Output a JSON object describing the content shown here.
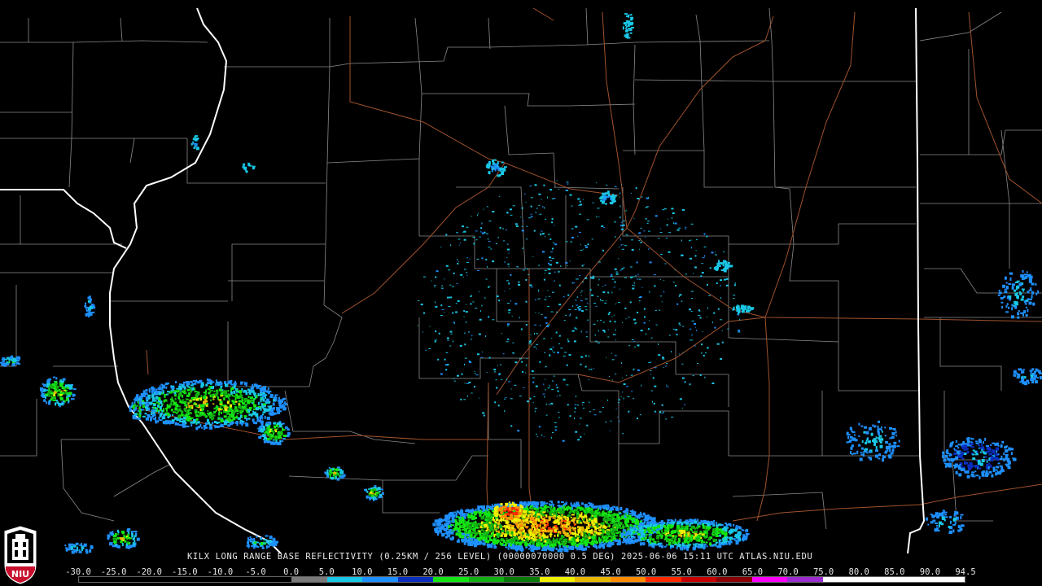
{
  "product_caption": "KILX LONG RANGE BASE REFLECTIVITY (0.25KM / 256 LEVEL) (00000070000 0.5 DEG) 2025-06-06 15:11 UTC  ATLAS.NIU.EDU",
  "logo_text": "NIU",
  "scale": {
    "labels": [
      "-30.0",
      "-25.0",
      "-20.0",
      "-15.0",
      "-10.0",
      "-5.0",
      "0.0",
      "5.0",
      "10.0",
      "15.0",
      "20.0",
      "25.0",
      "30.0",
      "35.0",
      "40.0",
      "45.0",
      "50.0",
      "55.0",
      "60.0",
      "65.0",
      "70.0",
      "75.0",
      "80.0",
      "85.0",
      "90.0",
      "94.5"
    ],
    "colors": [
      "#000000",
      "#000000",
      "#000000",
      "#000000",
      "#000000",
      "#000000",
      "#7a7a7a",
      "#19c7e6",
      "#1e90ff",
      "#0a2fbf",
      "#14e614",
      "#12b012",
      "#0a7a0a",
      "#f0f000",
      "#e6b800",
      "#ff8c00",
      "#ff2a00",
      "#c80000",
      "#8b0000",
      "#ff00ff",
      "#9c2cd1",
      "#ffffff",
      "#ffffff",
      "#ffffff",
      "#ffffff"
    ]
  },
  "colors": {
    "background": "#000000",
    "county_lines": "#8a8a8a",
    "state_lines": "#ffffff",
    "highways": "#a0522d"
  }
}
